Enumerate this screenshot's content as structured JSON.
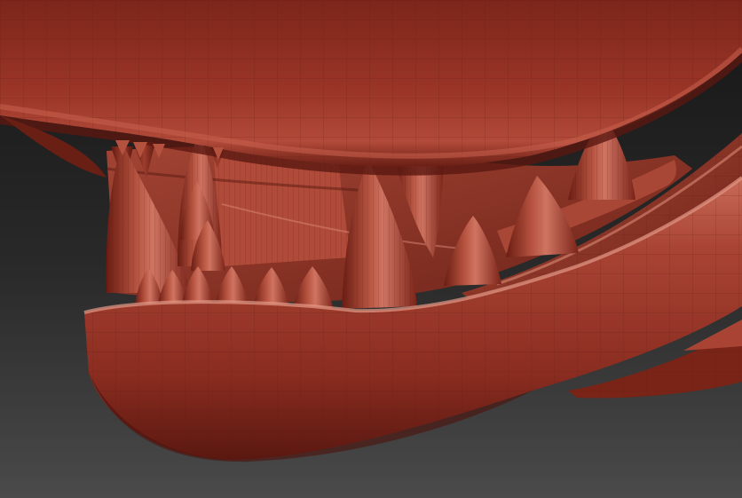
{
  "scene": {
    "subject": "sculpted-creature-jaw",
    "colors": {
      "background_top": "#1a1a1a",
      "background_bottom": "#4a4a4a",
      "clay_base": "#8f2e22",
      "clay_light": "#c25a48",
      "clay_dark": "#4e130c",
      "clay_highlight": "#e08a78",
      "wire": "#5e1a11"
    }
  }
}
